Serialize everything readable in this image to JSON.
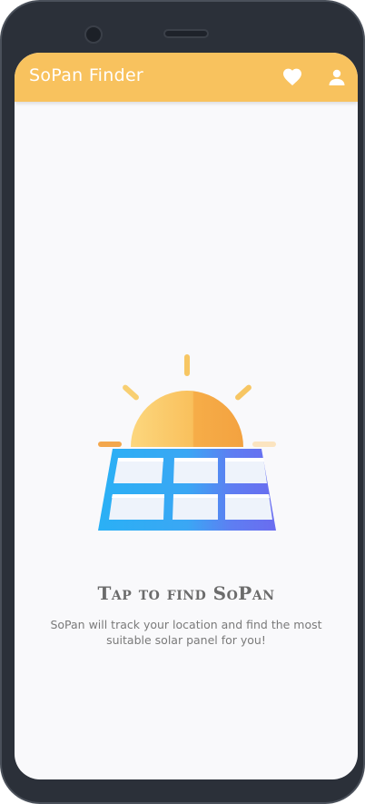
{
  "appbar": {
    "title": "SoPan Finder",
    "favorites_icon": "heart-icon",
    "profile_icon": "person-icon",
    "accent_color": "#f8c25e"
  },
  "main": {
    "illustration": "sun-over-solar-panel",
    "headline": "Tap to find SoPan",
    "description": "SoPan will track your location and find the most suitable solar panel for you!"
  }
}
